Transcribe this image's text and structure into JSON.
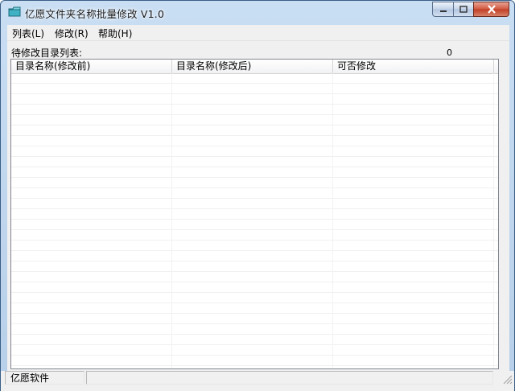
{
  "window": {
    "title": "亿愿文件夹名称批量修改 V1.0"
  },
  "menu": {
    "items": [
      {
        "label": "列表(L)"
      },
      {
        "label": "修改(R)"
      },
      {
        "label": "帮助(H)"
      }
    ]
  },
  "main": {
    "list_label": "待修改目录列表:",
    "count": "0",
    "columns": [
      {
        "label": "目录名称(修改前)"
      },
      {
        "label": "目录名称(修改后)"
      },
      {
        "label": "可否修改"
      }
    ],
    "rows": []
  },
  "statusbar": {
    "text": "亿愿软件"
  },
  "colors": {
    "title_bg": "#c9def3",
    "close_button": "#c13c24",
    "client_bg": "#f0f0f0"
  }
}
